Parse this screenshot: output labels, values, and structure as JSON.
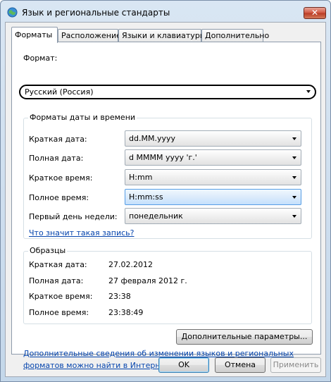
{
  "window": {
    "title": "Язык и региональные стандарты",
    "close_symbol": "✕",
    "title_icon": "globe-icon"
  },
  "tabs": [
    {
      "label": "Форматы",
      "active": true
    },
    {
      "label": "Расположение",
      "active": false
    },
    {
      "label": "Языки и клавиатуры",
      "active": false
    },
    {
      "label": "Дополнительно",
      "active": false
    }
  ],
  "format": {
    "label": "Формат:",
    "selected": "Русский (Россия)"
  },
  "date_time_formats": {
    "title": "Форматы даты и времени",
    "rows": [
      {
        "label": "Краткая дата:",
        "value": "dd.MM.yyyy"
      },
      {
        "label": "Полная дата:",
        "value": "d MMMM yyyy 'г.'"
      },
      {
        "label": "Краткое время:",
        "value": "H:mm"
      },
      {
        "label": "Полное время:",
        "value": "H:mm:ss"
      },
      {
        "label": "Первый день недели:",
        "value": "понедельник"
      }
    ],
    "help_link": "Что значит такая запись?"
  },
  "samples": {
    "title": "Образцы",
    "rows": [
      {
        "label": "Краткая дата:",
        "value": "27.02.2012"
      },
      {
        "label": "Полная дата:",
        "value": "27 февраля 2012 г."
      },
      {
        "label": "Краткое время:",
        "value": "23:38"
      },
      {
        "label": "Полное время:",
        "value": "23:38:49"
      }
    ]
  },
  "additional_settings_button": "Дополнительные параметры...",
  "info_link_line1": "Дополнительные сведения об изменении языков и региональных",
  "info_link_line2": "форматов можно найти в Интернете",
  "buttons": {
    "ok": "OK",
    "cancel": "Отмена",
    "apply": "Применить"
  }
}
